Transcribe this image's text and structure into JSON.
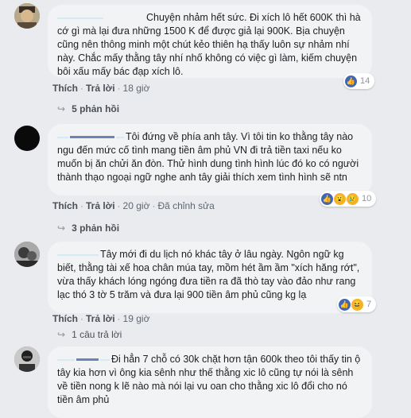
{
  "comments": [
    {
      "text": "Chuyện nhảm hết sức. Đi xích lô hết 600K thì hà cớ gì mà lại đưa những 1500 K để được giả lại 900K. Bịa chuyện cũng nên thông minh một chút kẻo thiên hạ thấy luôn sự nhảm nhí này. Chắc mấy thằng tây nhí nhố không có việc gì làm, kiếm chuyện bôi xấu mấy bác đạp xích lô.",
      "like_label": "Thích",
      "reply_label": "Trả lời",
      "time": "18 giờ",
      "reaction_count": "14",
      "replies_label": "5 phản hồi"
    },
    {
      "text": "Tôi đứng về phía anh tây. Vì tôi tin ko thằng tây nào ngu đến mức cố tình mang tiền âm phủ VN đi trả tiền taxi nếu ko muốn bị ăn chửi ăn đòn. Thử hình dung tình hình lúc đó ko có người thành thạo ngoại ngữ nghe anh tây giải thích xem tình hình sẽ ntn",
      "like_label": "Thích",
      "reply_label": "Trả lời",
      "time": "20 giờ",
      "edited": "Đã chỉnh sửa",
      "reaction_count": "10",
      "replies_label": "3 phản hồi"
    },
    {
      "text": "Tây mới đi du lịch nó khác tây ở lâu ngày. Ngôn ngữ kg biết, thằng tài xế hoa chân múa tay, mồm hét ầm ầm \"xích hăng rớt\", vừa thấy khách lóng ngóng đưa tiền ra đã thò tay vào đảo như rang lạc thó 3 tờ 5 trăm và đưa lại 900 tiền âm phủ cũng kg lạ",
      "like_label": "Thích",
      "reply_label": "Trả lời",
      "time": "19 giờ",
      "reaction_count": "7",
      "replies_label": "1 câu trả lời"
    },
    {
      "text": "Đi hẳn 7 chỗ có 30k chặt hơn tận 600k theo tôi thấy tin ộ tây kia hơn vì ông kia sênh như thế thằng xic lô cũng tự nói là sênh về tiền nong k lẽ nào mà nói lại vu oan cho thằng xic lô đổi cho nó tiền âm phủ"
    }
  ],
  "colors": {
    "accent": "#4267b2",
    "bubble": "#f2f3f5",
    "background": "#e9ebee"
  }
}
